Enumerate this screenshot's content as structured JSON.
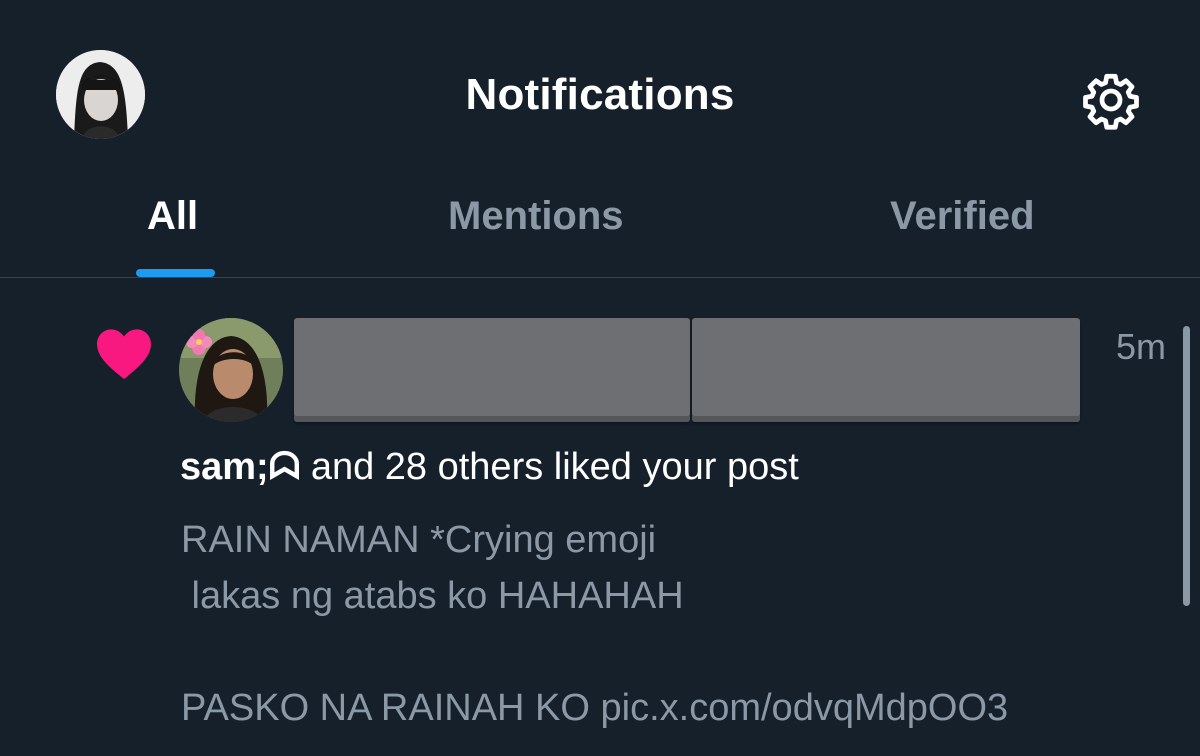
{
  "header": {
    "title": "Notifications",
    "profile_avatar_icon": "profile-avatar",
    "settings_icon": "gear-icon"
  },
  "tabs": [
    {
      "label": "All",
      "active": true
    },
    {
      "label": "Mentions",
      "active": false
    },
    {
      "label": "Verified",
      "active": false
    }
  ],
  "colors": {
    "background": "#15202b",
    "accent": "#1d9bf0",
    "like": "#f91880",
    "muted_text": "#8b98a5"
  },
  "notification": {
    "type_icon": "heart-icon",
    "liker_avatar_icon": "user-avatar",
    "time": "5m",
    "liker_name": "sam;ᗣ",
    "summary_rest": " and 28 others liked your post",
    "post_lines": [
      "RAIN NAMAN *Crying emoji",
      " lakas ng atabs ko HAHAHAH",
      "",
      "PASKO NA RAINAH KO pic.x.com/odvqMdpOO3"
    ]
  }
}
